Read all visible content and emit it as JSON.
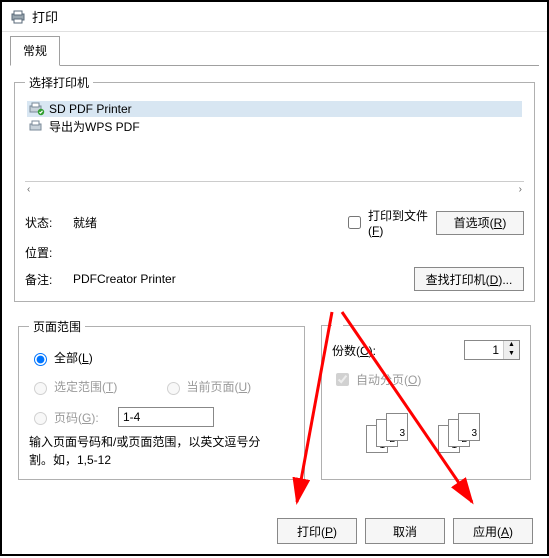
{
  "window": {
    "title": "打印"
  },
  "tabs": {
    "general": "常规"
  },
  "printerSelect": {
    "legend": "选择打印机",
    "items": [
      {
        "name": "SD PDF Printer"
      },
      {
        "name": "导出为WPS PDF"
      }
    ],
    "statusLabel": "状态:",
    "statusValue": "就绪",
    "locationLabel": "位置:",
    "locationValue": "",
    "commentLabel": "备注:",
    "commentValue": "PDFCreator Printer",
    "printToFile": "打印到文件(F)",
    "preferences": "首选项(R)",
    "findPrinter": "查找打印机(D)..."
  },
  "pageRange": {
    "legend": "页面范围",
    "all": "全部(L)",
    "selection": "选定范围(T)",
    "current": "当前页面(U)",
    "pages": "页码(G):",
    "pagesValue": "1-4",
    "hint1": "输入页面号码和/或页面范围，以英文逗号分",
    "hint2": "割。如，1,5-12"
  },
  "copies": {
    "copiesLabel": "份数(C):",
    "copiesValue": "1",
    "collate": "自动分页(O)"
  },
  "footer": {
    "print": "打印(P)",
    "cancel": "取消",
    "apply": "应用(A)"
  }
}
